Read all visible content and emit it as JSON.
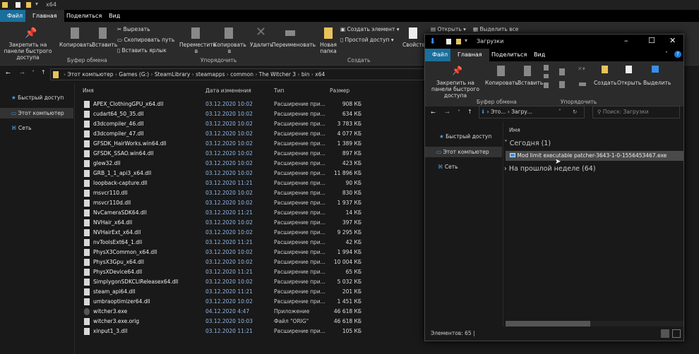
{
  "main": {
    "title": "x64",
    "tabs": [
      "Файл",
      "Главная",
      "Поделиться",
      "Вид"
    ],
    "ribbon": {
      "pin": "Закрепить на панели быстрого доступа",
      "copy": "Копировать",
      "paste": "Вставить",
      "cut": "Вырезать",
      "copy_path": "Скопировать путь",
      "paste_shortcut": "Вставить ярлык",
      "group_clipboard": "Буфер обмена",
      "move_to": "Переместить в",
      "copy_to": "Копировать в",
      "delete": "Удалить",
      "rename": "Переименовать",
      "group_organize": "Упорядочить",
      "new_folder": "Новая папка",
      "new_item": "Создать элемент",
      "easy_access": "Простой доступ",
      "group_new": "Создать",
      "properties": "Свойства",
      "open": "Открыть",
      "select_all": "Выделить все"
    },
    "breadcrumb": [
      "Этот компьютер",
      "Games (G:)",
      "SteamLibrary",
      "steamapps",
      "common",
      "The Witcher 3",
      "bin",
      "x64"
    ],
    "nav": [
      "Быстрый доступ",
      "Этот компьютер",
      "Сеть"
    ],
    "columns": [
      "Имя",
      "Дата изменения",
      "Тип",
      "Размер"
    ],
    "files": [
      [
        "APEX_ClothingGPU_x64.dll",
        "03.12.2020 10:02",
        "Расширение при...",
        "908 КБ"
      ],
      [
        "cudart64_50_35.dll",
        "03.12.2020 10:02",
        "Расширение при...",
        "634 КБ"
      ],
      [
        "d3dcompiler_46.dll",
        "03.12.2020 10:02",
        "Расширение при...",
        "3 783 КБ"
      ],
      [
        "d3dcompiler_47.dll",
        "03.12.2020 10:02",
        "Расширение при...",
        "4 077 КБ"
      ],
      [
        "GFSDK_HairWorks.win64.dll",
        "03.12.2020 10:02",
        "Расширение при...",
        "1 389 КБ"
      ],
      [
        "GFSDK_SSAO.win64.dll",
        "03.12.2020 10:02",
        "Расширение при...",
        "897 КБ"
      ],
      [
        "glew32.dll",
        "03.12.2020 10:02",
        "Расширение при...",
        "423 КБ"
      ],
      [
        "GRB_1_1_api3_x64.dll",
        "03.12.2020 10:02",
        "Расширение при...",
        "11 896 КБ"
      ],
      [
        "loopback-capture.dll",
        "03.12.2020 11:21",
        "Расширение при...",
        "90 КБ"
      ],
      [
        "msvcr110.dll",
        "03.12.2020 10:02",
        "Расширение при...",
        "830 КБ"
      ],
      [
        "msvcr110d.dll",
        "03.12.2020 10:02",
        "Расширение при...",
        "1 937 КБ"
      ],
      [
        "NvCameraSDK64.dll",
        "03.12.2020 11:21",
        "Расширение при...",
        "14 КБ"
      ],
      [
        "NVHair_x64.dll",
        "03.12.2020 10:02",
        "Расширение при...",
        "397 КБ"
      ],
      [
        "NVHairExt_x64.dll",
        "03.12.2020 10:02",
        "Расширение при...",
        "9 295 КБ"
      ],
      [
        "nvToolsExt64_1.dll",
        "03.12.2020 11:21",
        "Расширение при...",
        "42 КБ"
      ],
      [
        "PhysX3Common_x64.dll",
        "03.12.2020 10:02",
        "Расширение при...",
        "1 994 КБ"
      ],
      [
        "PhysX3Gpu_x64.dll",
        "03.12.2020 10:02",
        "Расширение при...",
        "10 004 КБ"
      ],
      [
        "PhysXDevice64.dll",
        "03.12.2020 11:21",
        "Расширение при...",
        "65 КБ"
      ],
      [
        "SimplygonSDKCLIReleasex64.dll",
        "03.12.2020 10:02",
        "Расширение при...",
        "5 032 КБ"
      ],
      [
        "steam_api64.dll",
        "03.12.2020 11:21",
        "Расширение при...",
        "201 КБ"
      ],
      [
        "umbraoptimizer64.dll",
        "03.12.2020 10:02",
        "Расширение при...",
        "1 451 КБ"
      ],
      [
        "witcher3.exe",
        "04.12.2020 4:47",
        "Приложение",
        "46 618 КБ"
      ],
      [
        "witcher3.exe.orig",
        "03.12.2020 10:03",
        "Файл \"ORIG\"",
        "46 618 КБ"
      ],
      [
        "xinput1_3.dll",
        "03.12.2020 11:21",
        "Расширение при...",
        "105 КБ"
      ]
    ]
  },
  "downloads": {
    "title": "Загрузки",
    "tabs": [
      "Файл",
      "Главная",
      "Поделиться",
      "Вид"
    ],
    "ribbon": {
      "pin": "Закрепить на панели быстрого доступа",
      "copy": "Копировать",
      "paste": "Вставить",
      "group_clipboard": "Буфер обмена",
      "group_organize": "Упорядочить",
      "create": "Создать",
      "open": "Открыть",
      "select": "Выделить"
    },
    "breadcrumb": [
      "Это...",
      "Загру..."
    ],
    "search_placeholder": "Поиск: Загрузки",
    "nav": [
      "Быстрый доступ",
      "Этот компьютер",
      "Сеть"
    ],
    "column": "Имя",
    "group_today": "Сегодня (1)",
    "file": "Mod limit executable patcher-3643-1-0-1556453467.exe",
    "group_last_week": "На прошлой неделе (64)",
    "status": "Элементов: 65"
  },
  "colors": {
    "accent": "#1a6f9c",
    "date": "#8fb6e6"
  }
}
